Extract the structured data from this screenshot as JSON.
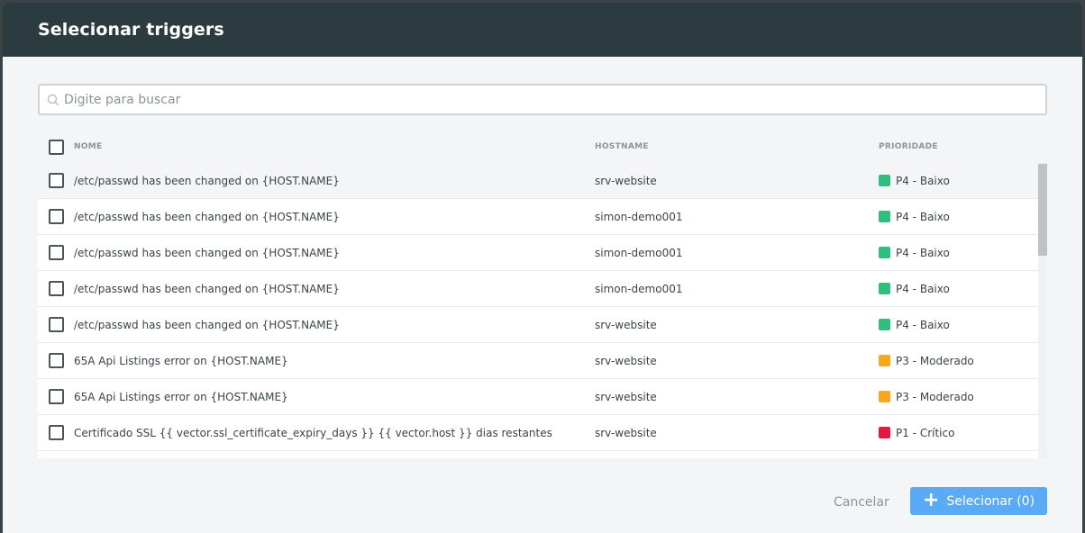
{
  "dialog": {
    "title": "Selecionar triggers",
    "search": {
      "placeholder": "Digite para buscar",
      "value": ""
    },
    "columns": {
      "name": "NOME",
      "hostname": "HOSTNAME",
      "priority": "PRIORIDADE"
    },
    "rows": [
      {
        "name": "/etc/passwd has been changed on {HOST.NAME}",
        "hostname": "srv-website",
        "priority": "P4 - Baixo",
        "priority_color": "#2ebf7f"
      },
      {
        "name": "/etc/passwd has been changed on {HOST.NAME}",
        "hostname": "simon-demo001",
        "priority": "P4 - Baixo",
        "priority_color": "#2ebf7f"
      },
      {
        "name": "/etc/passwd has been changed on {HOST.NAME}",
        "hostname": "simon-demo001",
        "priority": "P4 - Baixo",
        "priority_color": "#2ebf7f"
      },
      {
        "name": "/etc/passwd has been changed on {HOST.NAME}",
        "hostname": "simon-demo001",
        "priority": "P4 - Baixo",
        "priority_color": "#2ebf7f"
      },
      {
        "name": "/etc/passwd has been changed on {HOST.NAME}",
        "hostname": "srv-website",
        "priority": "P4 - Baixo",
        "priority_color": "#2ebf7f"
      },
      {
        "name": "65A Api Listings error on {HOST.NAME}",
        "hostname": "srv-website",
        "priority": "P3 - Moderado",
        "priority_color": "#f7a81b"
      },
      {
        "name": "65A Api Listings error on {HOST.NAME}",
        "hostname": "srv-website",
        "priority": "P3 - Moderado",
        "priority_color": "#f7a81b"
      },
      {
        "name": "Certificado SSL {{ vector.ssl_certificate_expiry_days }} {{ vector.host }} dias restantes",
        "hostname": "srv-website",
        "priority": "P1 - Crítico",
        "priority_color": "#e8163f"
      }
    ],
    "footer": {
      "cancel_label": "Cancelar",
      "select_label": "Selecionar (0)"
    }
  },
  "colors": {
    "header_bg": "#2c3b40",
    "primary_button": "#5aabf5"
  }
}
